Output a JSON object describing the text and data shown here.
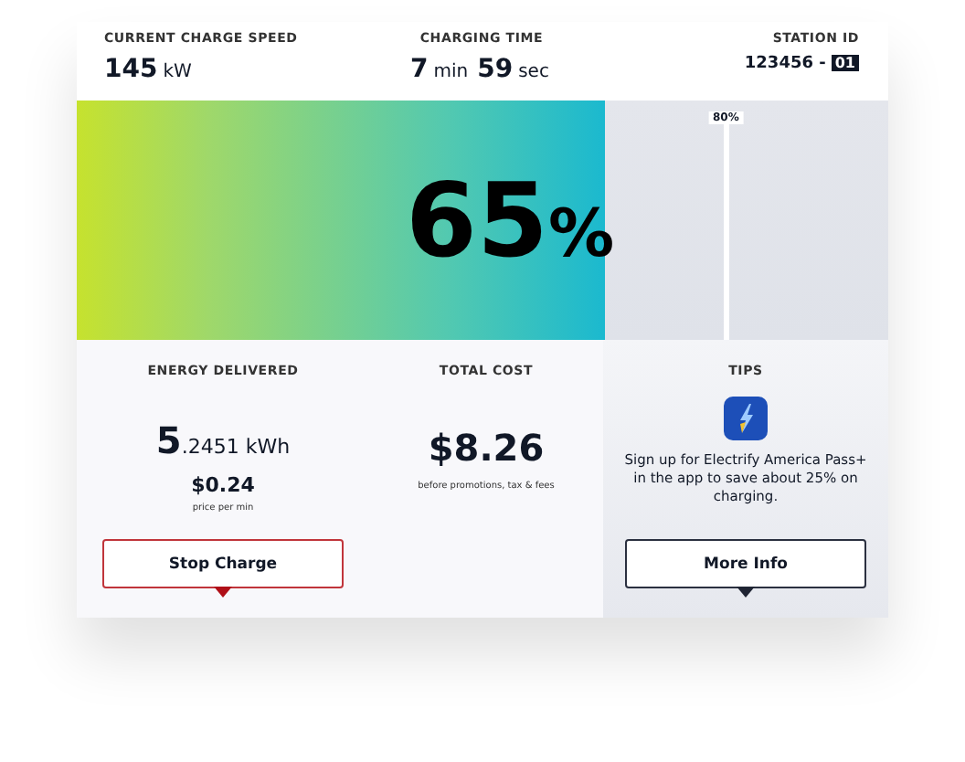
{
  "header": [
    {
      "label": "CURRENT CHARGE SPEED",
      "parts": [
        {
          "text": "145",
          "kind": "number"
        },
        {
          "text": "kW",
          "kind": "unit"
        }
      ]
    },
    {
      "label": "CHARGING TIME",
      "parts": [
        {
          "text": "7",
          "kind": "number"
        },
        {
          "text": "min",
          "kind": "unit"
        },
        {
          "text": "59",
          "kind": "number"
        },
        {
          "text": "sec",
          "kind": "unit"
        }
      ]
    },
    {
      "label": "STATION ID",
      "parts": [
        {
          "text": "123456 -",
          "kind": "id"
        },
        {
          "text": "01",
          "kind": "tag"
        }
      ]
    }
  ],
  "gauge": {
    "level": 0.65,
    "value": "65",
    "unit": "%",
    "marker": {
      "level": 0.8,
      "label": "80%"
    }
  },
  "energy": {
    "label": "ENERGY DELIVERED",
    "whole": "5",
    "fraction": ".2451 kWh",
    "price": "$0.24",
    "price_note": "price per min"
  },
  "cost": {
    "label": "TOTAL COST",
    "value": "$8.26",
    "note": "before promotions, tax & fees"
  },
  "tips": {
    "label": "TIPS",
    "text": "Sign up for Electrify America Pass+ in the app to save about 25% on charging."
  },
  "buttons": [
    {
      "label": "Stop Charge",
      "kind": "danger"
    },
    {
      "label": "More Info",
      "kind": "neutral"
    }
  ]
}
